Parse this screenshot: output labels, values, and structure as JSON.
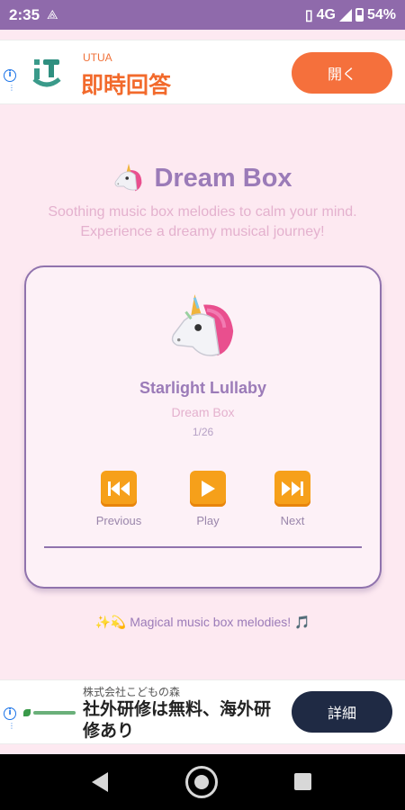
{
  "status_bar": {
    "time": "2:35",
    "network": "4G",
    "battery": "54%"
  },
  "top_ad": {
    "brand": "UTUA",
    "headline": "即時回答",
    "cta": "開く"
  },
  "header": {
    "title": "Dream Box",
    "subtitle_line1": "Soothing music box melodies to calm your mind.",
    "subtitle_line2": "Experience a dreamy musical journey!"
  },
  "player": {
    "song_title": "Starlight Lullaby",
    "artist": "Dream Box",
    "track_position": "1/26",
    "progress": 0,
    "controls": {
      "previous": "Previous",
      "play": "Play",
      "next": "Next"
    }
  },
  "tagline": "✨💫 Magical music box melodies! 🎵",
  "bottom_ad": {
    "company": "株式会社こどもの森",
    "headline": "社外研修は無料、海外研修あり",
    "cta": "詳細"
  },
  "colors": {
    "status_bar": "#8f6aab",
    "background": "#fde9f1",
    "accent": "#9b7bb8",
    "control_button": "#f6a01a",
    "top_ad_cta": "#f5703c",
    "bottom_ad_cta": "#1f2a44"
  },
  "icons": {
    "title": "unicorn-icon",
    "album_art": "unicorn-icon",
    "previous": "rewind-icon",
    "play": "play-icon",
    "next": "fast-forward-icon"
  }
}
